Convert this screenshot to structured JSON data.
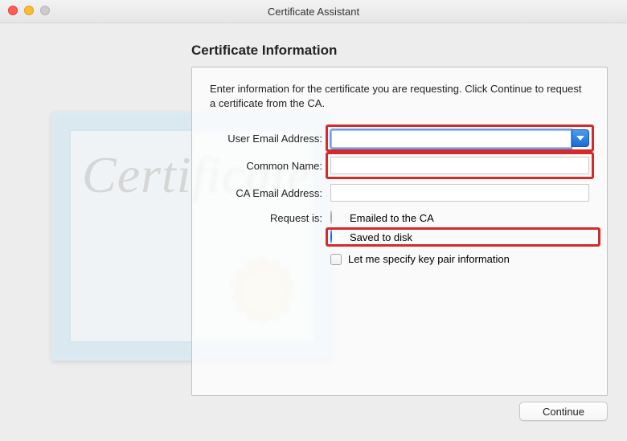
{
  "window": {
    "title": "Certificate Assistant"
  },
  "header": {
    "title": "Certificate Information"
  },
  "panel": {
    "description": "Enter information for the certificate you are requesting. Click Continue to request a certificate from the CA.",
    "fields": {
      "user_email": {
        "label": "User Email Address:",
        "value": ""
      },
      "common_name": {
        "label": "Common Name:",
        "value": ""
      },
      "ca_email": {
        "label": "CA Email Address:",
        "value": ""
      }
    },
    "request": {
      "label": "Request is:",
      "options": {
        "emailed": {
          "label": "Emailed to the CA",
          "selected": false
        },
        "saved": {
          "label": "Saved to disk",
          "selected": true
        }
      }
    },
    "keypair_checkbox": {
      "label": "Let me specify key pair information",
      "checked": false
    },
    "cert_placeholder_text": "Certificate"
  },
  "footer": {
    "continue": "Continue"
  },
  "colors": {
    "highlight": "#d32b2b",
    "accent": "#0a7aff"
  }
}
